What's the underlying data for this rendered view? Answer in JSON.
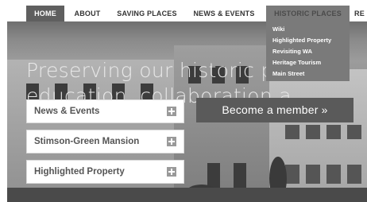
{
  "nav": {
    "items": [
      {
        "label": "HOME"
      },
      {
        "label": "ABOUT"
      },
      {
        "label": "SAVING PLACES"
      },
      {
        "label": "NEWS & EVENTS"
      },
      {
        "label": "HISTORIC PLACES"
      },
      {
        "label": "RE"
      }
    ]
  },
  "dropdown": {
    "items": [
      "Wiki",
      "Highlighted Property",
      "Revisiting WA",
      "Heritage Tourism",
      "Main Street"
    ]
  },
  "hero": {
    "line1": "Preserving our historic pla",
    "line2": "education, collaboration a"
  },
  "panels": [
    {
      "label": "News & Events"
    },
    {
      "label": "Stimson-Green Mansion"
    },
    {
      "label": "Highlighted Property"
    }
  ],
  "cta": {
    "label": "Become a member »"
  }
}
